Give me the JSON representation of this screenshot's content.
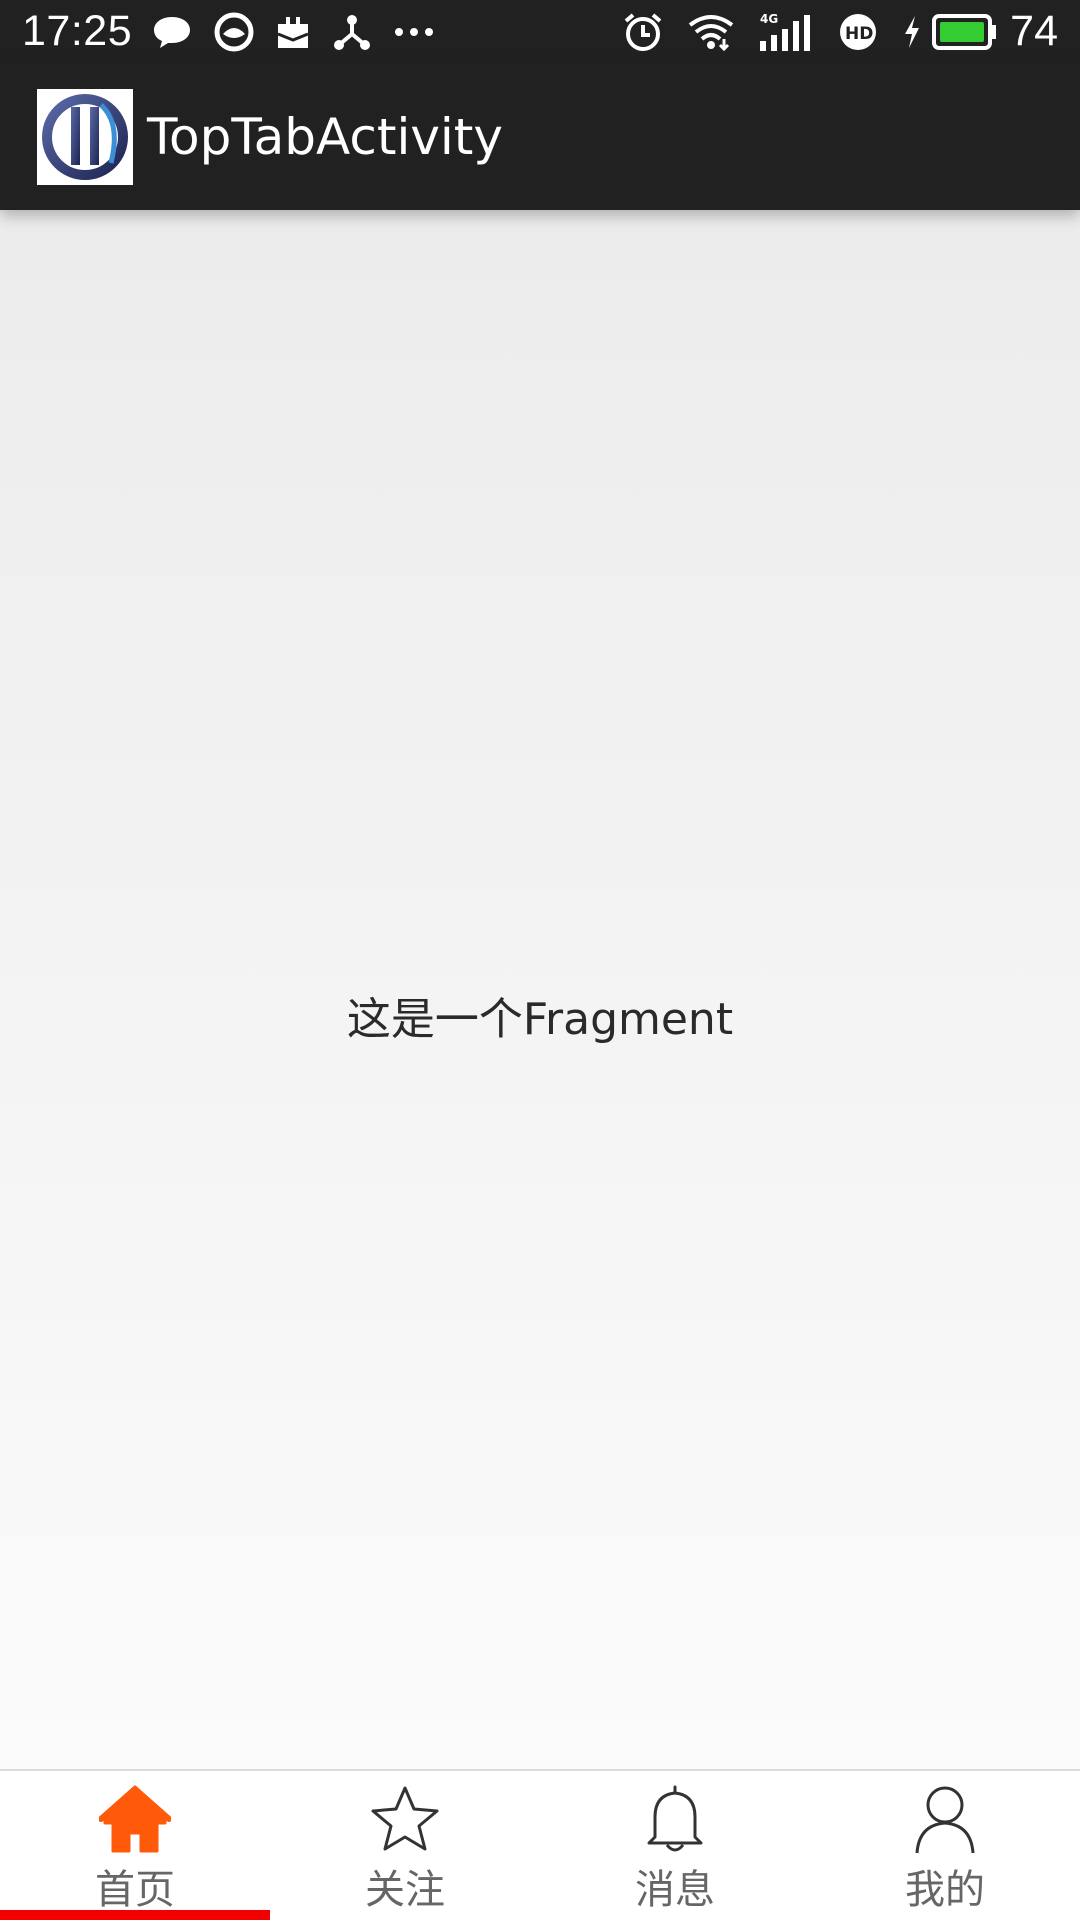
{
  "status_bar": {
    "time": "17:25",
    "battery_level": "74",
    "left_icons": [
      "chat-bubble-icon",
      "app-circle-icon",
      "briefcase-icon",
      "share-node-icon",
      "more-dots-icon"
    ],
    "right_icons": [
      "alarm-icon",
      "wifi-icon",
      "signal-4g-icon",
      "hd-icon",
      "charging-icon",
      "battery-icon"
    ],
    "battery_color": "#33cc33"
  },
  "app_bar": {
    "title": "TopTabActivity",
    "background": "#212121"
  },
  "content": {
    "text": "这是一个Fragment"
  },
  "bottom_nav": {
    "active_index": 0,
    "active_color": "#ff5a0a",
    "indicator_color": "#f20000",
    "tabs": [
      {
        "label": "首页",
        "icon": "home-icon"
      },
      {
        "label": "关注",
        "icon": "star-icon"
      },
      {
        "label": "消息",
        "icon": "bell-icon"
      },
      {
        "label": "我的",
        "icon": "person-icon"
      }
    ]
  }
}
